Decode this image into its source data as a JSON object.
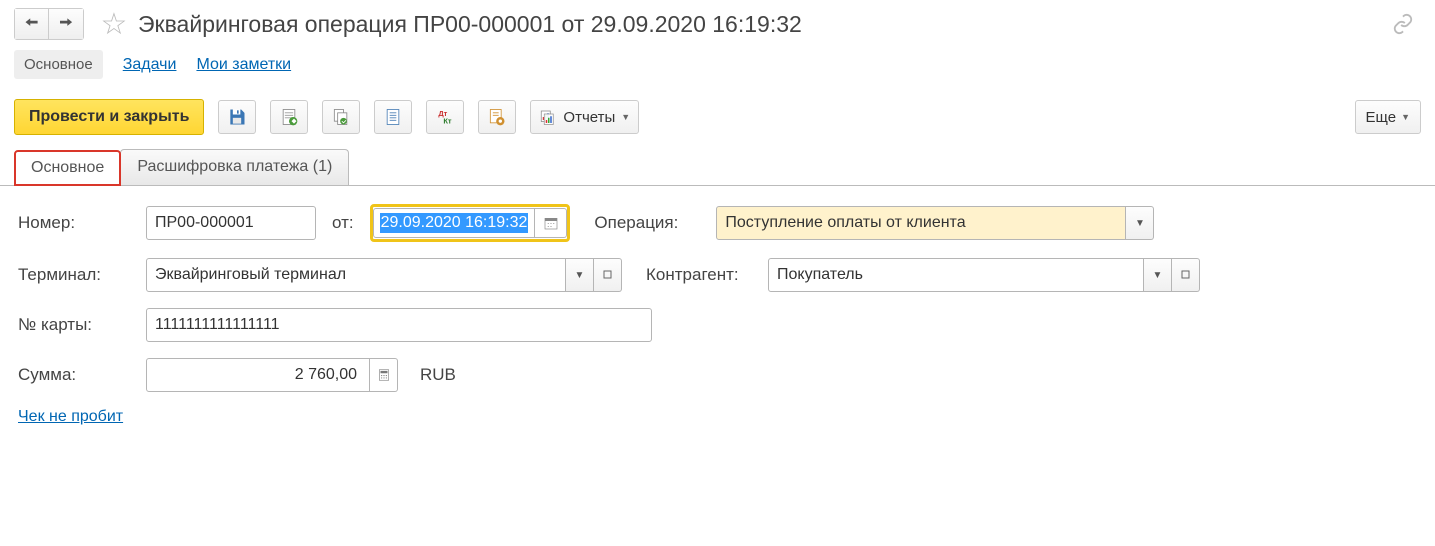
{
  "title": "Эквайринговая операция ПР00-000001 от 29.09.2020 16:19:32",
  "nav": {
    "main": "Основное",
    "tasks": "Задачи",
    "notes": "Мои заметки"
  },
  "toolbar": {
    "post_close": "Провести и закрыть",
    "reports": "Отчеты",
    "more": "Еще"
  },
  "tabs": {
    "main": "Основное",
    "decode": "Расшифровка платежа (1)"
  },
  "form": {
    "number_label": "Номер:",
    "number_value": "ПР00-000001",
    "from_label": "от:",
    "date_value": "29.09.2020 16:19:32",
    "operation_label": "Операция:",
    "operation_value": "Поступление оплаты от клиента",
    "terminal_label": "Терминал:",
    "terminal_value": "Эквайринговый терминал",
    "counterparty_label": "Контрагент:",
    "counterparty_value": "Покупатель",
    "card_label": "№ карты:",
    "card_value": "1111111111111111",
    "sum_label": "Сумма:",
    "sum_value": "2 760,00",
    "currency": "RUB",
    "receipt_link": "Чек не пробит"
  }
}
